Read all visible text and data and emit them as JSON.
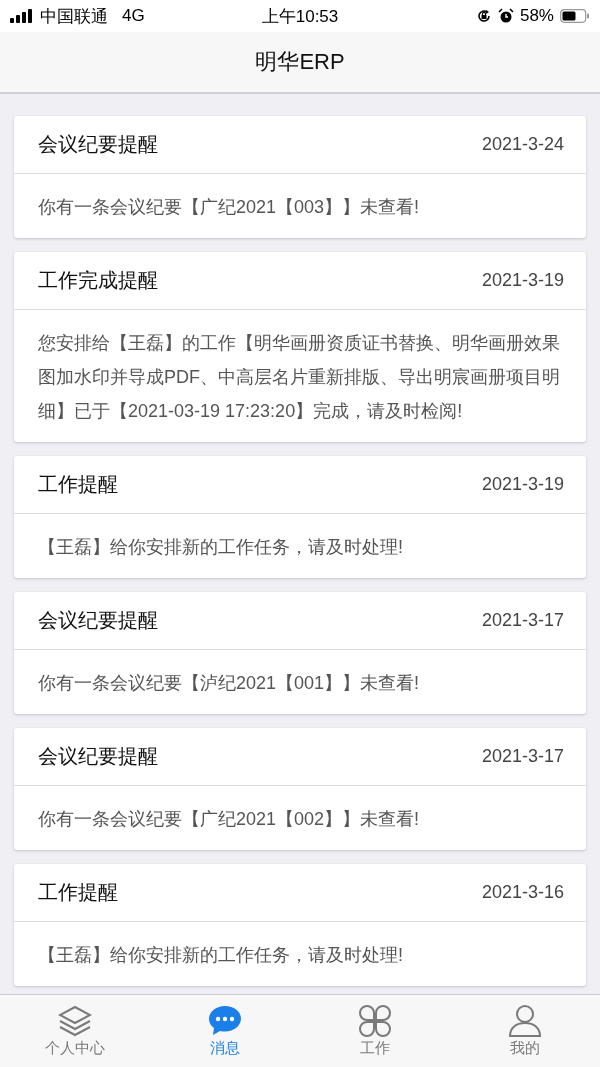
{
  "status_bar": {
    "carrier": "中国联通",
    "network": "4G",
    "time": "上午10:53",
    "battery": "58%"
  },
  "header": {
    "title": "明华ERP"
  },
  "messages": [
    {
      "title": "会议纪要提醒",
      "date": "2021-3-24",
      "body": "你有一条会议纪要【广纪2021【003】】未查看!"
    },
    {
      "title": "工作完成提醒",
      "date": "2021-3-19",
      "body": "您安排给【王磊】的工作【明华画册资质证书替换、明华画册效果图加水印并导成PDF、中高层名片重新排版、导出明宸画册项目明细】已于【2021-03-19 17:23:20】完成，请及时检阅!"
    },
    {
      "title": "工作提醒",
      "date": "2021-3-19",
      "body": "【王磊】给你安排新的工作任务，请及时处理!"
    },
    {
      "title": "会议纪要提醒",
      "date": "2021-3-17",
      "body": "你有一条会议纪要【泸纪2021【001】】未查看!"
    },
    {
      "title": "会议纪要提醒",
      "date": "2021-3-17",
      "body": "你有一条会议纪要【广纪2021【002】】未查看!"
    },
    {
      "title": "工作提醒",
      "date": "2021-3-16",
      "body": "【王磊】给你安排新的工作任务，请及时处理!"
    }
  ],
  "tab_bar": [
    {
      "label": "个人中心",
      "selected": false
    },
    {
      "label": "消息",
      "selected": true
    },
    {
      "label": "工作",
      "selected": false
    },
    {
      "label": "我的",
      "selected": false
    }
  ]
}
